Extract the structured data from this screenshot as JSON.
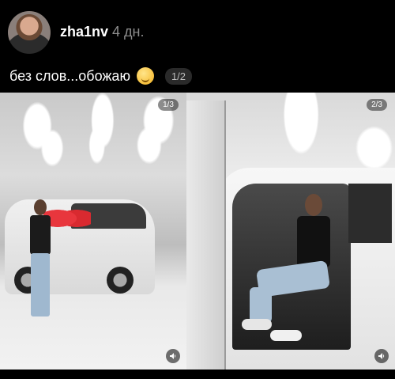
{
  "post": {
    "username": "zha1nv",
    "time": "4 дн.",
    "caption": "без слов...обожаю",
    "caption_emoji": "smiling-face-emoji",
    "carousel_counter": "1/2"
  },
  "media": [
    {
      "counter": "1/3",
      "sound_icon": "speaker-icon"
    },
    {
      "counter": "2/3",
      "sound_icon": "speaker-icon"
    }
  ],
  "colors": {
    "background": "#000000",
    "text": "#ffffff",
    "muted_text": "#8d8d8d"
  }
}
